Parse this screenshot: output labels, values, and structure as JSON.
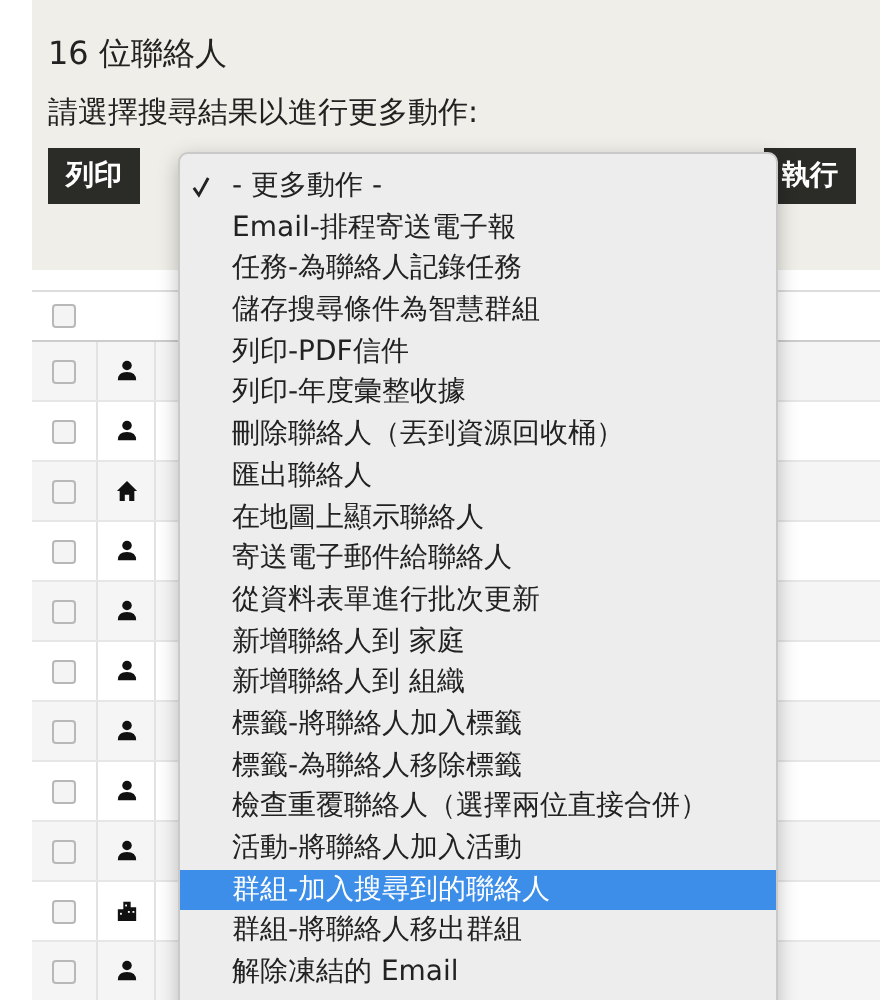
{
  "title": "16 位聯絡人",
  "instruction": "請選擇搜尋結果以進行更多動作:",
  "buttons": [
    {
      "label": "列印"
    },
    {
      "label": "執行"
    }
  ],
  "table": {
    "header": {
      "checked": false
    },
    "rows": [
      {
        "kind": "person",
        "checked": false
      },
      {
        "kind": "person",
        "checked": false
      },
      {
        "kind": "household",
        "checked": false
      },
      {
        "kind": "person",
        "checked": false
      },
      {
        "kind": "person",
        "checked": false
      },
      {
        "kind": "person",
        "checked": false
      },
      {
        "kind": "person",
        "checked": false
      },
      {
        "kind": "person",
        "checked": false
      },
      {
        "kind": "person",
        "checked": false
      },
      {
        "kind": "organization",
        "checked": false
      },
      {
        "kind": "person",
        "checked": false
      }
    ]
  },
  "menu": {
    "items": [
      {
        "label": "- 更多動作 -",
        "checked": true,
        "selected": false
      },
      {
        "label": "Email-排程寄送電子報",
        "checked": false,
        "selected": false
      },
      {
        "label": "任務-為聯絡人記錄任務",
        "checked": false,
        "selected": false
      },
      {
        "label": "儲存搜尋條件為智慧群組",
        "checked": false,
        "selected": false
      },
      {
        "label": "列印-PDF信件",
        "checked": false,
        "selected": false
      },
      {
        "label": "列印-年度彙整收據",
        "checked": false,
        "selected": false
      },
      {
        "label": "刪除聯絡人（丟到資源回收桶）",
        "checked": false,
        "selected": false
      },
      {
        "label": "匯出聯絡人",
        "checked": false,
        "selected": false
      },
      {
        "label": "在地圖上顯示聯絡人",
        "checked": false,
        "selected": false
      },
      {
        "label": "寄送電子郵件給聯絡人",
        "checked": false,
        "selected": false
      },
      {
        "label": "從資料表單進行批次更新",
        "checked": false,
        "selected": false
      },
      {
        "label": "新增聯絡人到 家庭",
        "checked": false,
        "selected": false
      },
      {
        "label": "新增聯絡人到 組織",
        "checked": false,
        "selected": false
      },
      {
        "label": "標籤-將聯絡人加入標籤",
        "checked": false,
        "selected": false
      },
      {
        "label": "標籤-為聯絡人移除標籤",
        "checked": false,
        "selected": false
      },
      {
        "label": "檢查重覆聯絡人（選擇兩位直接合併）",
        "checked": false,
        "selected": false
      },
      {
        "label": "活動-將聯絡人加入活動",
        "checked": false,
        "selected": false
      },
      {
        "label": "群組-加入搜尋到的聯絡人",
        "checked": false,
        "selected": true
      },
      {
        "label": "群組-將聯絡人移出群組",
        "checked": false,
        "selected": false
      },
      {
        "label": "解除凍結的 Email",
        "checked": false,
        "selected": false
      }
    ]
  }
}
